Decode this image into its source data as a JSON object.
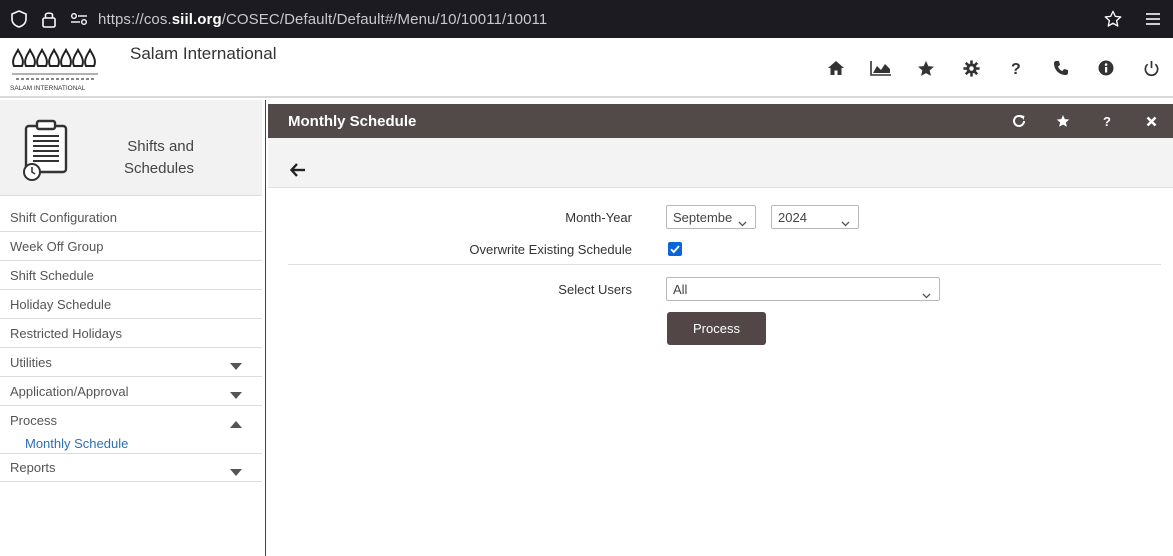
{
  "browser": {
    "url_prefix": "https://cos.",
    "url_domain": "siil.org",
    "url_path": "/COSEC/Default/Default#/Menu/10/10011/10011"
  },
  "header": {
    "company_name": "Salam International",
    "logo_text": "SALAM INTERNATIONAL",
    "icons": [
      "home-icon",
      "chart-icon",
      "star-icon",
      "gear-icon",
      "help-icon",
      "phone-icon",
      "info-icon",
      "power-icon"
    ]
  },
  "sidebar": {
    "module_title_line1": "Shifts and",
    "module_title_line2": "Schedules",
    "items": [
      {
        "label": "Shift Configuration"
      },
      {
        "label": "Week Off Group"
      },
      {
        "label": "Shift Schedule"
      },
      {
        "label": "Holiday Schedule"
      },
      {
        "label": "Restricted Holidays"
      },
      {
        "label": "Utilities",
        "expandable": "collapsed"
      },
      {
        "label": "Application/Approval",
        "expandable": "collapsed"
      },
      {
        "label": "Process",
        "expandable": "expanded"
      },
      {
        "label": "Reports",
        "expandable": "collapsed"
      }
    ],
    "process_subitems": [
      {
        "label": "Monthly Schedule"
      }
    ]
  },
  "panel": {
    "title": "Monthly Schedule",
    "icons": [
      "refresh-icon",
      "star-icon",
      "help-icon",
      "close-icon"
    ]
  },
  "form": {
    "month_year_label": "Month-Year",
    "month_value": "Septembe",
    "year_value": "2024",
    "overwrite_label": "Overwrite Existing Schedule",
    "overwrite_checked": true,
    "select_users_label": "Select Users",
    "select_users_value": "All",
    "process_button": "Process"
  },
  "colors": {
    "panel_header": "#514a49",
    "link_blue": "#2d6fb5",
    "checkbox_blue": "#0a65d9",
    "browser_bar": "#1c1b22"
  }
}
